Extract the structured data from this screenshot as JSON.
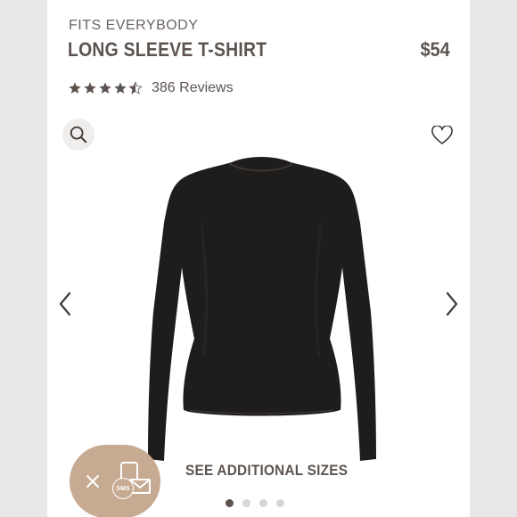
{
  "product": {
    "brand": "FITS EVERYBODY",
    "title": "LONG SLEEVE T-SHIRT",
    "price": "$54",
    "rating_value": 4.5,
    "rating_max": 5,
    "reviews_label": "386 Reviews"
  },
  "actions": {
    "see_sizes_label": "SEE ADDITIONAL SIZES",
    "sms_badge": "SMS"
  },
  "carousel": {
    "total_slides": 4,
    "active_slide": 1
  },
  "colors": {
    "text_primary": "#5d5450",
    "sms_widget": "#c7aa92",
    "product_fabric": "#1f1d1c"
  },
  "icons": [
    "search-icon",
    "heart-icon",
    "chevron-left-icon",
    "chevron-right-icon",
    "close-icon",
    "phone-mail-icon",
    "star-icon"
  ]
}
